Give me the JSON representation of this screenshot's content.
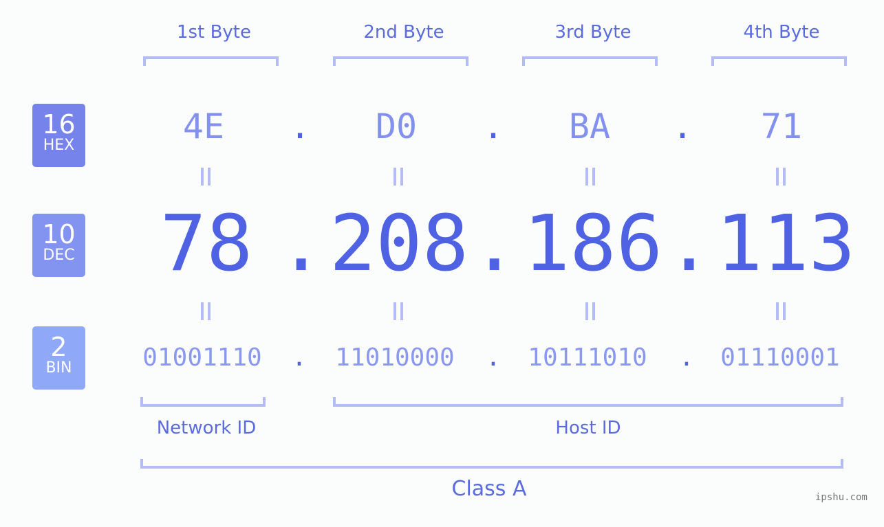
{
  "badges": [
    {
      "num": "16",
      "label": "HEX",
      "color": "#7583ea"
    },
    {
      "num": "10",
      "label": "DEC",
      "color": "#8393f0"
    },
    {
      "num": "2",
      "label": "BIN",
      "color": "#8fa8f8"
    }
  ],
  "byte_labels": [
    "1st Byte",
    "2nd Byte",
    "3rd Byte",
    "4th Byte"
  ],
  "hex": [
    "4E",
    "D0",
    "BA",
    "71"
  ],
  "dec": [
    "78",
    "208",
    "186",
    "113"
  ],
  "bin": [
    "01001110",
    "11010000",
    "10111010",
    "01110001"
  ],
  "separator": ".",
  "equals": "=",
  "network_id_label": "Network ID",
  "host_id_label": "Host ID",
  "class_label": "Class A",
  "watermark": "ipshu.com"
}
